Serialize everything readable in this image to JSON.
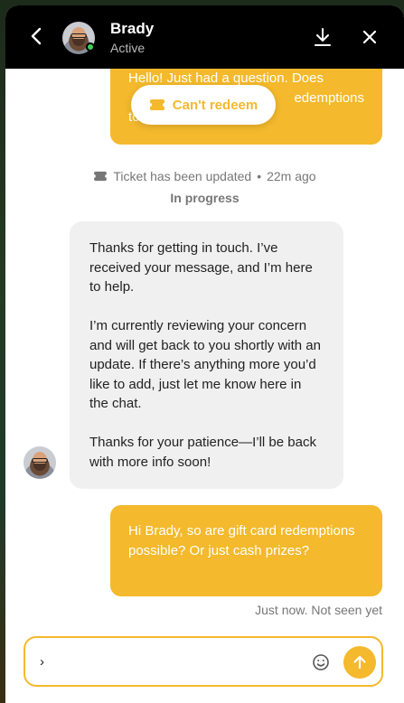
{
  "header": {
    "name": "Brady",
    "status": "Active",
    "icons": {
      "back": "chevron-left-icon",
      "download": "download-icon",
      "close": "close-icon"
    }
  },
  "messages": {
    "top_user_text": "Hello! Just had a question. Does Can't redeem card redemptions to...",
    "top_user_visible_line1": "Hello! Just had a question. Does",
    "top_user_visible_line2_right": "edemptions",
    "top_user_visible_line3": "to",
    "pill_label": "Can't redeem",
    "ticket_update": "Ticket has been updated",
    "ticket_time": "22m ago",
    "ticket_status": "In progress",
    "agent_paragraphs": [
      "Thanks for getting in touch. I’ve received your message, and I’m here to help.",
      "I’m currently reviewing your concern and will get back to you shortly with an update. If there’s anything more you’d like to add, just let me know here in the chat.",
      "Thanks for your patience—I’ll be back with more info soon!"
    ],
    "user_latest": "Hi Brady, so are gift card redemptions possible? Or just cash prizes?",
    "latest_meta": "Just now. Not seen yet"
  },
  "composer": {
    "value": "›",
    "placeholder": ""
  },
  "colors": {
    "accent": "#f4b92c",
    "header_bg": "#000000",
    "online": "#3ccf5a"
  }
}
